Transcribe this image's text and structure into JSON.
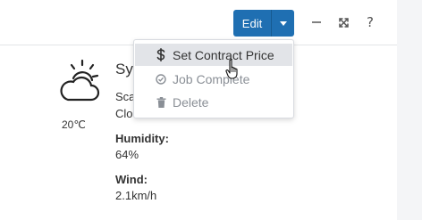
{
  "toolbar": {
    "edit_label": "Edit",
    "help_label": "?"
  },
  "dropdown": {
    "items": [
      {
        "label": "Set Contract Price",
        "icon": "dollar-icon",
        "state": "hovered"
      },
      {
        "label": "Job Complete",
        "icon": "check-circle-icon",
        "state": "enabled"
      },
      {
        "label": "Delete",
        "icon": "trash-icon",
        "state": "enabled"
      }
    ]
  },
  "weather": {
    "icon": "partly-cloudy-icon",
    "city_partial": "Syd",
    "desc_line1_partial": "Scat",
    "desc_line2_partial": "Clou",
    "temperature": "20℃",
    "humidity_label": "Humidity:",
    "humidity_value": "64%",
    "wind_label": "Wind:",
    "wind_value": "2.1km/h"
  },
  "colors": {
    "accent": "#1f6fb2",
    "hover_bg": "#e2e4e8",
    "muted_text": "#8a8f96"
  }
}
